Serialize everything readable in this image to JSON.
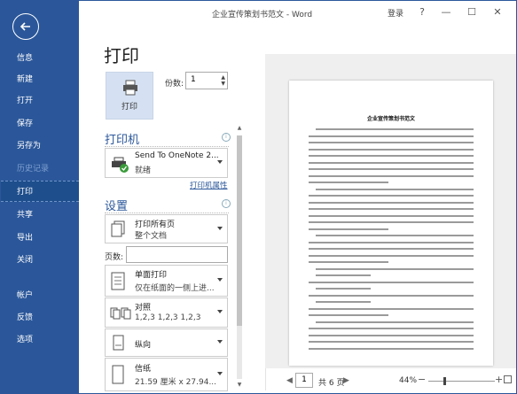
{
  "window": {
    "title": "企业宣传策划书范文 - Word",
    "login": "登录",
    "help": "?",
    "minimize": "—",
    "restore": "☐",
    "close": "✕"
  },
  "nav": {
    "items": [
      {
        "label": "信息"
      },
      {
        "label": "新建"
      },
      {
        "label": "打开"
      },
      {
        "label": "保存"
      },
      {
        "label": "另存为"
      },
      {
        "label": "历史记录"
      },
      {
        "label": "打印"
      },
      {
        "label": "共享"
      },
      {
        "label": "导出"
      },
      {
        "label": "关闭"
      },
      {
        "label": "帐户"
      },
      {
        "label": "反馈"
      },
      {
        "label": "选项"
      }
    ]
  },
  "print": {
    "heading": "打印",
    "button_label": "打印",
    "copies_label": "份数:",
    "copies_value": "1",
    "printer_section": "打印机",
    "printer_name": "Send To OneNote 2...",
    "printer_status": "就绪",
    "printer_properties": "打印机属性",
    "settings_section": "设置",
    "range_title": "打印所有页",
    "range_sub": "整个文档",
    "pages_label": "页数:",
    "pages_value": "",
    "sides_title": "单面打印",
    "sides_sub": "仅在纸面的一侧上进...",
    "collate_title": "对照",
    "collate_sub": "1,2,3   1,2,3   1,2,3",
    "orientation_title": "纵向",
    "paper_title": "信纸",
    "paper_sub": "21.59 厘米 x 27.94..."
  },
  "preview": {
    "doc_heading": "企业宣传策划书范文",
    "current_page": "1",
    "total_pages": "共 6 页",
    "zoom": "44%",
    "zoom_level": 0.44
  },
  "colors": {
    "nav_bg": "#2b579a",
    "accent": "#2b579a",
    "print_button_bg": "#d5e1f2"
  }
}
